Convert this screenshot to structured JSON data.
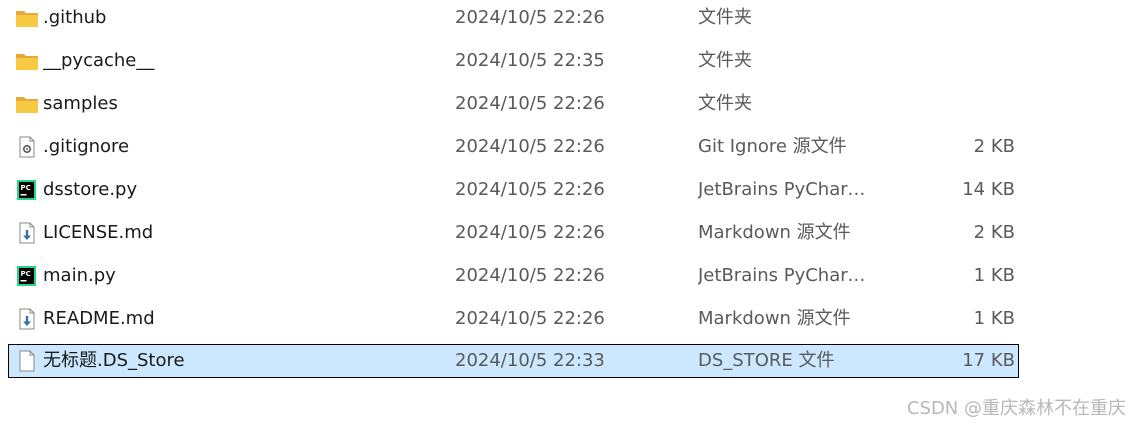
{
  "files": [
    {
      "name": ".github",
      "date": "2024/10/5 22:26",
      "type": "文件夹",
      "size": "",
      "icon": "folder-icon"
    },
    {
      "name": "__pycache__",
      "date": "2024/10/5 22:35",
      "type": "文件夹",
      "size": "",
      "icon": "folder-icon"
    },
    {
      "name": "samples",
      "date": "2024/10/5 22:26",
      "type": "文件夹",
      "size": "",
      "icon": "folder-icon"
    },
    {
      "name": ".gitignore",
      "date": "2024/10/5 22:26",
      "type": "Git Ignore 源文件",
      "size": "2 KB",
      "icon": "gear-file-icon"
    },
    {
      "name": "dsstore.py",
      "date": "2024/10/5 22:26",
      "type": "JetBrains PyCharm ...",
      "size": "14 KB",
      "icon": "pycharm-file-icon"
    },
    {
      "name": "LICENSE.md",
      "date": "2024/10/5 22:26",
      "type": "Markdown 源文件",
      "size": "2 KB",
      "icon": "markdown-file-icon"
    },
    {
      "name": "main.py",
      "date": "2024/10/5 22:26",
      "type": "JetBrains PyCharm ...",
      "size": "1 KB",
      "icon": "pycharm-file-icon"
    },
    {
      "name": "README.md",
      "date": "2024/10/5 22:26",
      "type": "Markdown 源文件",
      "size": "1 KB",
      "icon": "markdown-file-icon"
    },
    {
      "name": "无标题.DS_Store",
      "date": "2024/10/5 22:33",
      "type": "DS_STORE 文件",
      "size": "17 KB",
      "icon": "blank-file-icon",
      "selected": true
    }
  ],
  "watermark": "CSDN @重庆森林不在重庆",
  "colors": {
    "selection_bg": "#cce8ff",
    "selection_border": "#000000",
    "folder_yellow": "#f8c943",
    "pycharm_green": "#21d789"
  }
}
